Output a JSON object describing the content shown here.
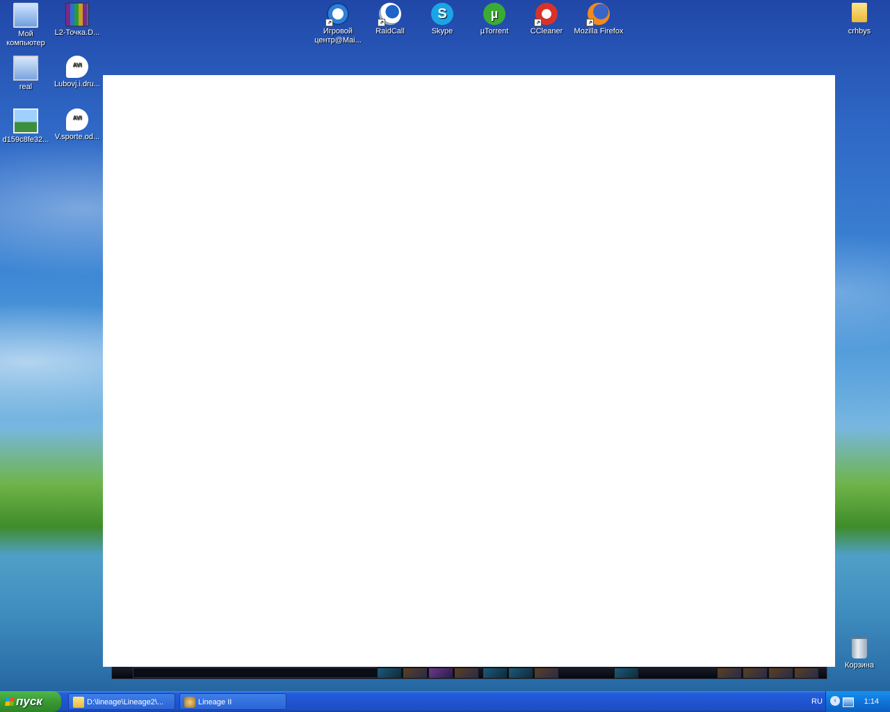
{
  "desktop": {
    "icons": [
      {
        "label": "Мой компьютер",
        "icon": "computer-icon"
      },
      {
        "label": "L2-Точка.D...",
        "icon": "archive-icon"
      },
      {
        "label": "real",
        "icon": "network-icon"
      },
      {
        "label": "Lubovj.i.dru...",
        "icon": "avi-file-icon"
      },
      {
        "label": "d159c8fe32...",
        "icon": "image-file-icon"
      },
      {
        "label": "V.sporte.od...",
        "icon": "avi-file-icon"
      },
      {
        "label": "Игровой центр@Mai...",
        "icon": "game-center-icon"
      },
      {
        "label": "RaidCall",
        "icon": "raidcall-icon"
      },
      {
        "label": "Skype",
        "icon": "skype-icon"
      },
      {
        "label": "µTorrent",
        "icon": "utorrent-icon"
      },
      {
        "label": "CCleaner",
        "icon": "ccleaner-icon"
      },
      {
        "label": "Mozilla Firefox",
        "icon": "firefox-icon"
      },
      {
        "label": "crhbys",
        "icon": "folder-icon"
      },
      {
        "label": "Корзина",
        "icon": "recycle-bin-icon"
      }
    ],
    "avi_badge": "AVI",
    "skype_glyph": "S",
    "utorrent_glyph": "µ"
  },
  "taskbar": {
    "start_label": "пуск",
    "tasks": [
      {
        "label": "D:\\lineage\\Lineage2\\...",
        "icon": "folder-icon"
      },
      {
        "label": "Lineage II",
        "icon": "game-icon"
      }
    ],
    "language": "RU",
    "clock": "1:14"
  }
}
